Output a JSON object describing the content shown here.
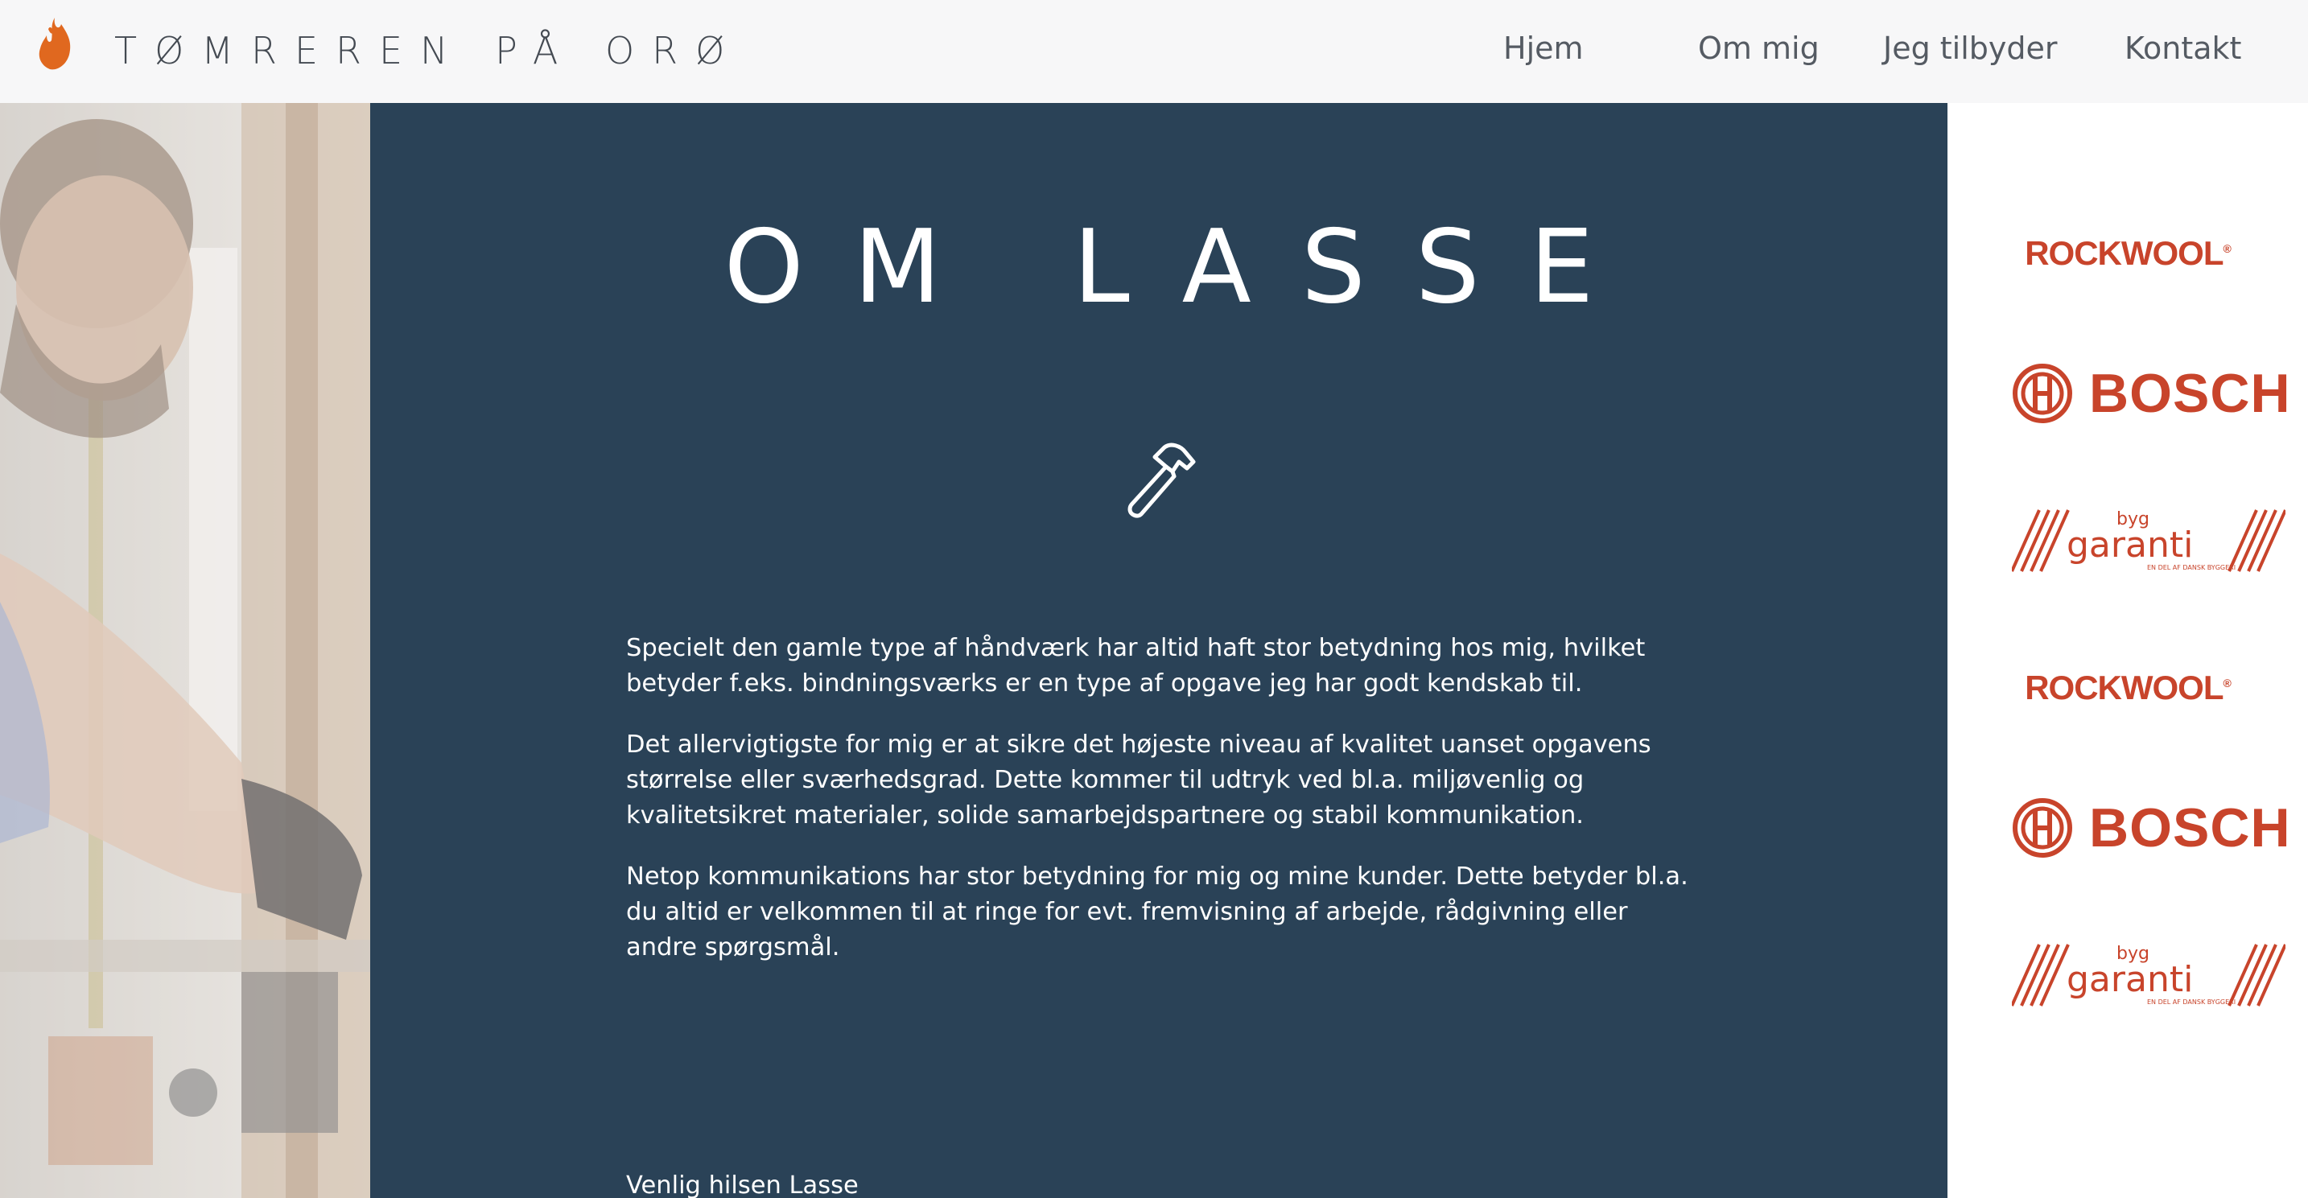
{
  "header": {
    "site_title": "TØMREREN PÅ ORØ",
    "logo_icon": "flame-icon",
    "nav": [
      {
        "label": "Hjem"
      },
      {
        "label": "Om mig"
      },
      {
        "label": "Jeg tilbyder"
      },
      {
        "label": "Kontakt"
      }
    ]
  },
  "main": {
    "title": "OM LASSE",
    "icon": "hammer-icon",
    "paragraphs": [
      "Specielt den gamle type af håndværk har altid haft stor betydning hos mig, hvilket betyder f.eks. bindningsværks er en type af opgave jeg har godt kendskab til.",
      "Det allervigtigste for mig er at sikre det højeste niveau af kvalitet uanset opgavens størrelse eller sværhedsgrad. Dette kommer til udtryk ved bl.a. miljøvenlig og kvalitetsikret materialer, solide samarbejdspartnere og stabil kommunikation.",
      "Netop kommunikations har stor betydning for mig og mine kunder. Dette betyder bl.a. du altid er velkommen til at ringe for evt. fremvisning af arbejde, rådgivning eller andre spørgsmål."
    ],
    "signature": "Venlig hilsen Lasse"
  },
  "partners": [
    {
      "name": "ROCKWOOL"
    },
    {
      "name": "BOSCH"
    },
    {
      "name_top": "byg",
      "name_main": "garanti",
      "tagline": "EN DEL AF DANSK BYGGERI"
    },
    {
      "name": "ROCKWOOL"
    },
    {
      "name": "BOSCH"
    },
    {
      "name_top": "byg",
      "name_main": "garanti",
      "tagline": "EN DEL AF DANSK BYGGERI"
    }
  ],
  "colors": {
    "header_bg": "#f7f7f8",
    "main_bg": "#2a4257",
    "accent": "#c8442b",
    "flame": "#e0681f"
  }
}
